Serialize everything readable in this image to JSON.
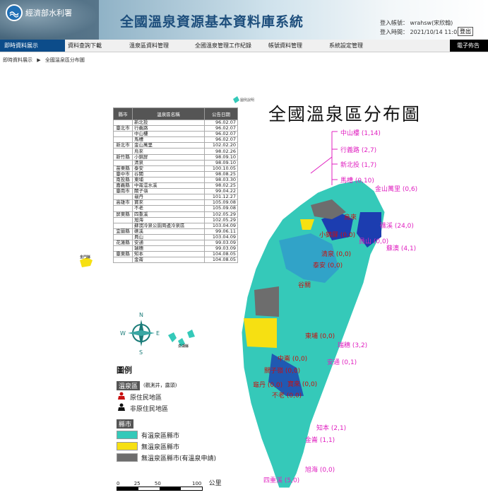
{
  "header": {
    "org_name": "經濟部水利署",
    "system_title": "全國溫泉資源基本資料庫系統",
    "login_account_label": "登入帳號",
    "login_account_value": "wrahsw(宋欣翰)",
    "login_time_label": "登入時間",
    "login_time_value": "2021/10/14 11:02:22",
    "logout_label": "登出"
  },
  "nav": {
    "items": [
      {
        "label": "即時資料展示"
      },
      {
        "label": "資料查詢下載"
      },
      {
        "label": "溫泉區資料管理"
      },
      {
        "label": "全國溫泉管理工作紀錄"
      },
      {
        "label": "帳號資料管理"
      },
      {
        "label": "系統設定管理"
      },
      {
        "label": "電子佈告欄"
      }
    ]
  },
  "breadcrumb": {
    "level1": "即時資料展示",
    "separator": "▶",
    "level2": "全國溫泉區分布圖"
  },
  "map": {
    "title": "全國溫泉區分布圖",
    "source_note": "圖例說明",
    "table_headers": [
      "縣市",
      "溫泉區名稱",
      "公告日期"
    ],
    "table_rows": [
      {
        "city": "",
        "name": "新北投",
        "date": "96.02.07"
      },
      {
        "city": "臺北市",
        "name": "行義路",
        "date": "96.02.07"
      },
      {
        "city": "",
        "name": "中山樓",
        "date": "96.02.07"
      },
      {
        "city": "",
        "name": "馬槽",
        "date": "96.02.07"
      },
      {
        "city": "新北市",
        "name": "金山萬里",
        "date": "102.02.20"
      },
      {
        "city": "",
        "name": "烏來",
        "date": "98.02.26"
      },
      {
        "city": "新竹縣",
        "name": "小錦屏",
        "date": "98.09.10"
      },
      {
        "city": "",
        "name": "清泉",
        "date": "98.09.10"
      },
      {
        "city": "苗栗縣",
        "name": "泰安",
        "date": "100.10.05"
      },
      {
        "city": "臺中市",
        "name": "谷關",
        "date": "98.08.25"
      },
      {
        "city": "南投縣",
        "name": "東埔",
        "date": "98.03.30"
      },
      {
        "city": "嘉義縣",
        "name": "中崙澐水溪",
        "date": "98.02.25"
      },
      {
        "city": "臺南市",
        "name": "關子嶺",
        "date": "99.04.22"
      },
      {
        "city": "",
        "name": "龜丹",
        "date": "101.12.27"
      },
      {
        "city": "高雄市",
        "name": "寶來",
        "date": "105.09.08"
      },
      {
        "city": "",
        "name": "不老",
        "date": "105.09.08"
      },
      {
        "city": "屏東縣",
        "name": "四重溪",
        "date": "102.05.29"
      },
      {
        "city": "",
        "name": "旭海",
        "date": "102.05.29"
      },
      {
        "city": "",
        "name": "蘇澳冷泉公園周邊冷泉區",
        "date": "103.04.09"
      },
      {
        "city": "宜蘭縣",
        "name": "礁溪",
        "date": "99.06.11"
      },
      {
        "city": "",
        "name": "員山",
        "date": "103.04.09"
      },
      {
        "city": "花蓮縣",
        "name": "安通",
        "date": "99.03.09"
      },
      {
        "city": "",
        "name": "瑞穗",
        "date": "99.03.09"
      },
      {
        "city": "臺東縣",
        "name": "知本",
        "date": "104.08.05"
      },
      {
        "city": "",
        "name": "金崙",
        "date": "104.08.05"
      }
    ],
    "north_labels": [
      "中山樓 (1,14)",
      "行義路 (2,7)",
      "新北投 (1,7)",
      "馬槽 (0,10)"
    ],
    "area_labels": [
      {
        "text": "金山萬里 (0,6)",
        "color": "magenta"
      },
      {
        "text": "烏來",
        "color": "red"
      },
      {
        "text": "礁溪 (24,0)",
        "color": "magenta"
      },
      {
        "text": "小錦屏 (0,0)",
        "color": "red"
      },
      {
        "text": "清泉 (0,0)",
        "color": "red"
      },
      {
        "text": "員山 (0,0)",
        "color": "magenta"
      },
      {
        "text": "蘇澳 (4,1)",
        "color": "magenta"
      },
      {
        "text": "泰安 (0,0)",
        "color": "red"
      },
      {
        "text": "谷關",
        "color": "red"
      },
      {
        "text": "東埔 (0,0)",
        "color": "red"
      },
      {
        "text": "瑞穗 (3,2)",
        "color": "magenta"
      },
      {
        "text": "安通 (0,1)",
        "color": "magenta"
      },
      {
        "text": "中崙 (0,0)",
        "color": "red"
      },
      {
        "text": "關子嶺 (0,0)",
        "color": "red"
      },
      {
        "text": "龜丹 (0,0)",
        "color": "red"
      },
      {
        "text": "寶來 (0,0)",
        "color": "red"
      },
      {
        "text": "不老 (0,0)",
        "color": "red"
      },
      {
        "text": "知本 (2,1)",
        "color": "magenta"
      },
      {
        "text": "金崙 (1,1)",
        "color": "magenta"
      },
      {
        "text": "旭海 (0,0)",
        "color": "magenta"
      },
      {
        "text": "四重溪 (5,0)",
        "color": "magenta"
      }
    ],
    "island_labels": [
      "金門縣",
      "澎湖縣",
      "連江縣"
    ],
    "compass": {
      "n": "N",
      "s": "S",
      "e": "E",
      "w": "W"
    },
    "legend": {
      "title": "圖例",
      "hotspring_tag": "溫泉區",
      "hotspring_note": "(觀測井，露頭)",
      "aboriginal": "原住民地區",
      "non_aboriginal": "非原住民地區",
      "county_tag": "縣市",
      "has_hotspring": "有溫泉區縣市",
      "no_hotspring": "無溫泉區縣市",
      "applying": "無溫泉區縣市(有溫泉申請)"
    },
    "scale": {
      "ticks": [
        "0",
        "25",
        "50",
        "100"
      ],
      "unit": "公里"
    },
    "colors": {
      "has": "#35c9b9",
      "none": "#f6e012",
      "applying": "#6d6d6d",
      "blue": "#1c3db0"
    }
  }
}
